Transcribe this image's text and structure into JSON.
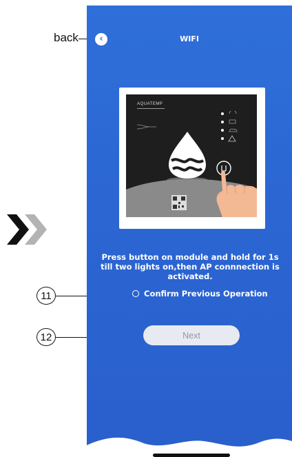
{
  "annotations": {
    "back_label": "back",
    "label_11": "11",
    "label_12": "12"
  },
  "header": {
    "title": "WIFI"
  },
  "module": {
    "logo": "AQUATEMP"
  },
  "content": {
    "instruction": "Press button on module and hold for 1s till two lights on,then AP connnection is activated.",
    "confirm_label": "Confirm Previous Operation",
    "confirm_checked": false,
    "next_label": "Next",
    "next_enabled": false
  },
  "colors": {
    "background_blue": "#2f6fd9",
    "button_disabled_bg": "#e7eaf0",
    "button_disabled_text": "#8d96a8"
  },
  "icons": [
    "chevron-left-icon",
    "radio-icon",
    "next-arrows-icon",
    "wifi-icon",
    "cloud-icon",
    "warning-icon",
    "droplet-logo-icon",
    "qr-code-icon",
    "hand-press-icon"
  ]
}
